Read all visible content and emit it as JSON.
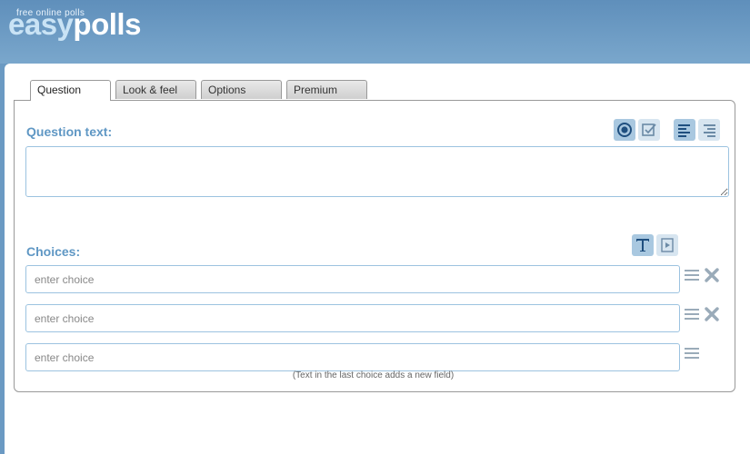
{
  "logo": {
    "tagline": "free online polls",
    "easy": "easy",
    "polls": "polls"
  },
  "tabs": [
    {
      "label": "Question",
      "active": true
    },
    {
      "label": "Look & feel",
      "active": false
    },
    {
      "label": "Options",
      "active": false
    },
    {
      "label": "Premium",
      "active": false
    }
  ],
  "question": {
    "label": "Question text:",
    "value": ""
  },
  "choices": {
    "label": "Choices:",
    "items": [
      {
        "placeholder": "enter choice",
        "value": "",
        "deletable": true
      },
      {
        "placeholder": "enter choice",
        "value": "",
        "deletable": true
      },
      {
        "placeholder": "enter choice",
        "value": "",
        "deletable": false
      }
    ],
    "hint": "(Text in the last choice adds a new field)"
  },
  "colors": {
    "accent": "#5f97c4",
    "header": "#6b9ac3",
    "icon_active": "#1f4f7f",
    "icon_inactive": "#6b8aa6"
  }
}
